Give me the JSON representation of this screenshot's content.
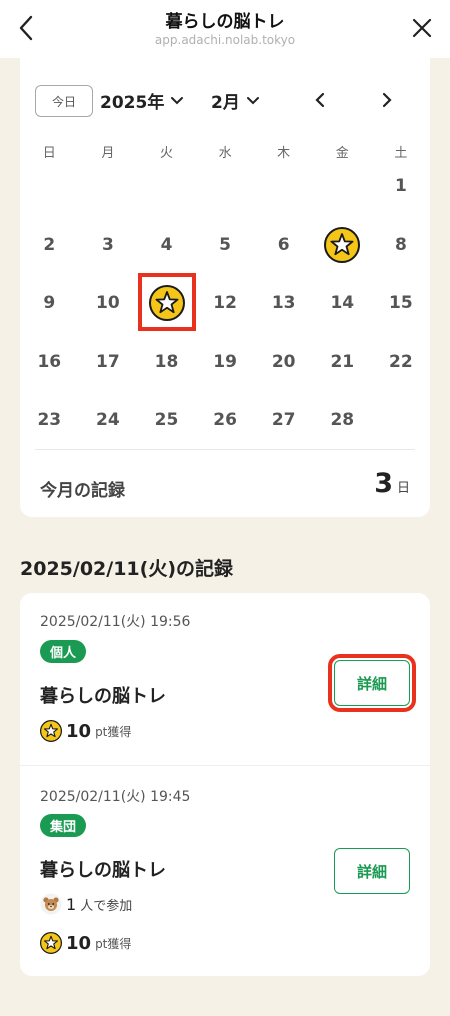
{
  "header": {
    "title": "暮らしの脳トレ",
    "url": "app.adachi.nolab.tokyo"
  },
  "calendar": {
    "today_label": "今日",
    "year_label": "2025年",
    "month_label": "2月",
    "weekdays": [
      "日",
      "月",
      "火",
      "水",
      "木",
      "金",
      "土"
    ],
    "days": [
      "1",
      "2",
      "3",
      "4",
      "5",
      "6",
      "7",
      "8",
      "9",
      "10",
      "11",
      "12",
      "13",
      "14",
      "15",
      "16",
      "17",
      "18",
      "19",
      "20",
      "21",
      "22",
      "23",
      "24",
      "25",
      "26",
      "27",
      "28"
    ],
    "starred_days": [
      "7",
      "11"
    ],
    "highlighted_day": "11",
    "month_record_label": "今月の記録",
    "month_record_value": "3",
    "month_record_unit": "日"
  },
  "records": {
    "section_title": "2025/02/11(火)の記録",
    "items": [
      {
        "time": "2025/02/11(火) 19:56",
        "badge": "個人",
        "name": "暮らしの脳トレ",
        "points": "10",
        "points_unit": "pt獲得",
        "detail_label": "詳細"
      },
      {
        "time": "2025/02/11(火) 19:45",
        "badge": "集団",
        "name": "暮らしの脳トレ",
        "participants": "1",
        "participants_unit": "人で参加",
        "points": "10",
        "points_unit": "pt獲得",
        "detail_label": "詳細"
      }
    ]
  },
  "colors": {
    "accent_green": "#1a9a52",
    "star_gold": "#f5c518",
    "highlight_red": "#e8321e",
    "page_bg": "#f5f1e6"
  }
}
